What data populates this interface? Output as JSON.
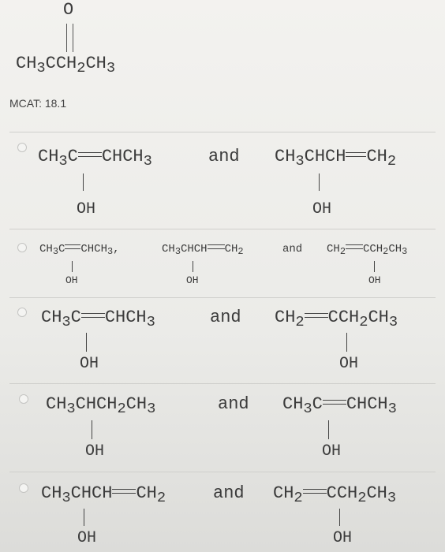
{
  "question": {
    "oxygen": "O",
    "formula_parts": [
      "CH",
      "3",
      "CCH",
      "2",
      "CH",
      "3"
    ],
    "label": "MCAT: 18.1"
  },
  "options": [
    {
      "id": "a",
      "selected": false,
      "left": {
        "pre": "CH",
        "s1": "3",
        "mid": "C",
        "post": "CHCH",
        "s2": "3",
        "oh": "OH"
      },
      "connector": "and",
      "right": {
        "pre": "CH",
        "s1": "3",
        "mid": "CHCH",
        "post": "CH",
        "s2": "2",
        "oh": "OH"
      }
    },
    {
      "id": "b",
      "selected": false,
      "first": {
        "pre": "CH",
        "s1": "3",
        "mid": "C",
        "post": "CHCH",
        "s2": "3",
        "tail": ",",
        "oh": "OH"
      },
      "second": {
        "pre": "CH",
        "s1": "3",
        "mid": "CHCH",
        "post": "CH",
        "s2": "2",
        "oh": "OH"
      },
      "connector": "and",
      "third": {
        "pre": "CH",
        "s1": "2",
        "post": "CCH",
        "s2": "2",
        "end": "CH",
        "s3": "3",
        "oh": "OH"
      }
    },
    {
      "id": "c",
      "selected": false,
      "left": {
        "pre": "CH",
        "s1": "3",
        "mid": "C",
        "post": "CHCH",
        "s2": "3",
        "oh": "OH"
      },
      "connector": "and",
      "right": {
        "pre": "CH",
        "s1": "2",
        "post": "CCH",
        "s2": "2",
        "end": "CH",
        "s3": "3",
        "oh": "OH"
      }
    },
    {
      "id": "d",
      "selected": false,
      "left": {
        "pre": "CH",
        "s1": "3",
        "mid": "CHCH",
        "s2": "2",
        "end": "CH",
        "s3": "3",
        "oh": "OH"
      },
      "connector": "and",
      "right": {
        "pre": "CH",
        "s1": "3",
        "mid": "C",
        "post": "CHCH",
        "s2": "3",
        "oh": "OH"
      }
    },
    {
      "id": "e",
      "selected": false,
      "left": {
        "pre": "CH",
        "s1": "3",
        "mid": "CHCH",
        "post": "CH",
        "s2": "2",
        "oh": "OH"
      },
      "connector": "and",
      "right": {
        "pre": "CH",
        "s1": "2",
        "post": "CCH",
        "s2": "2",
        "end": "CH",
        "s3": "3",
        "oh": "OH"
      }
    }
  ]
}
